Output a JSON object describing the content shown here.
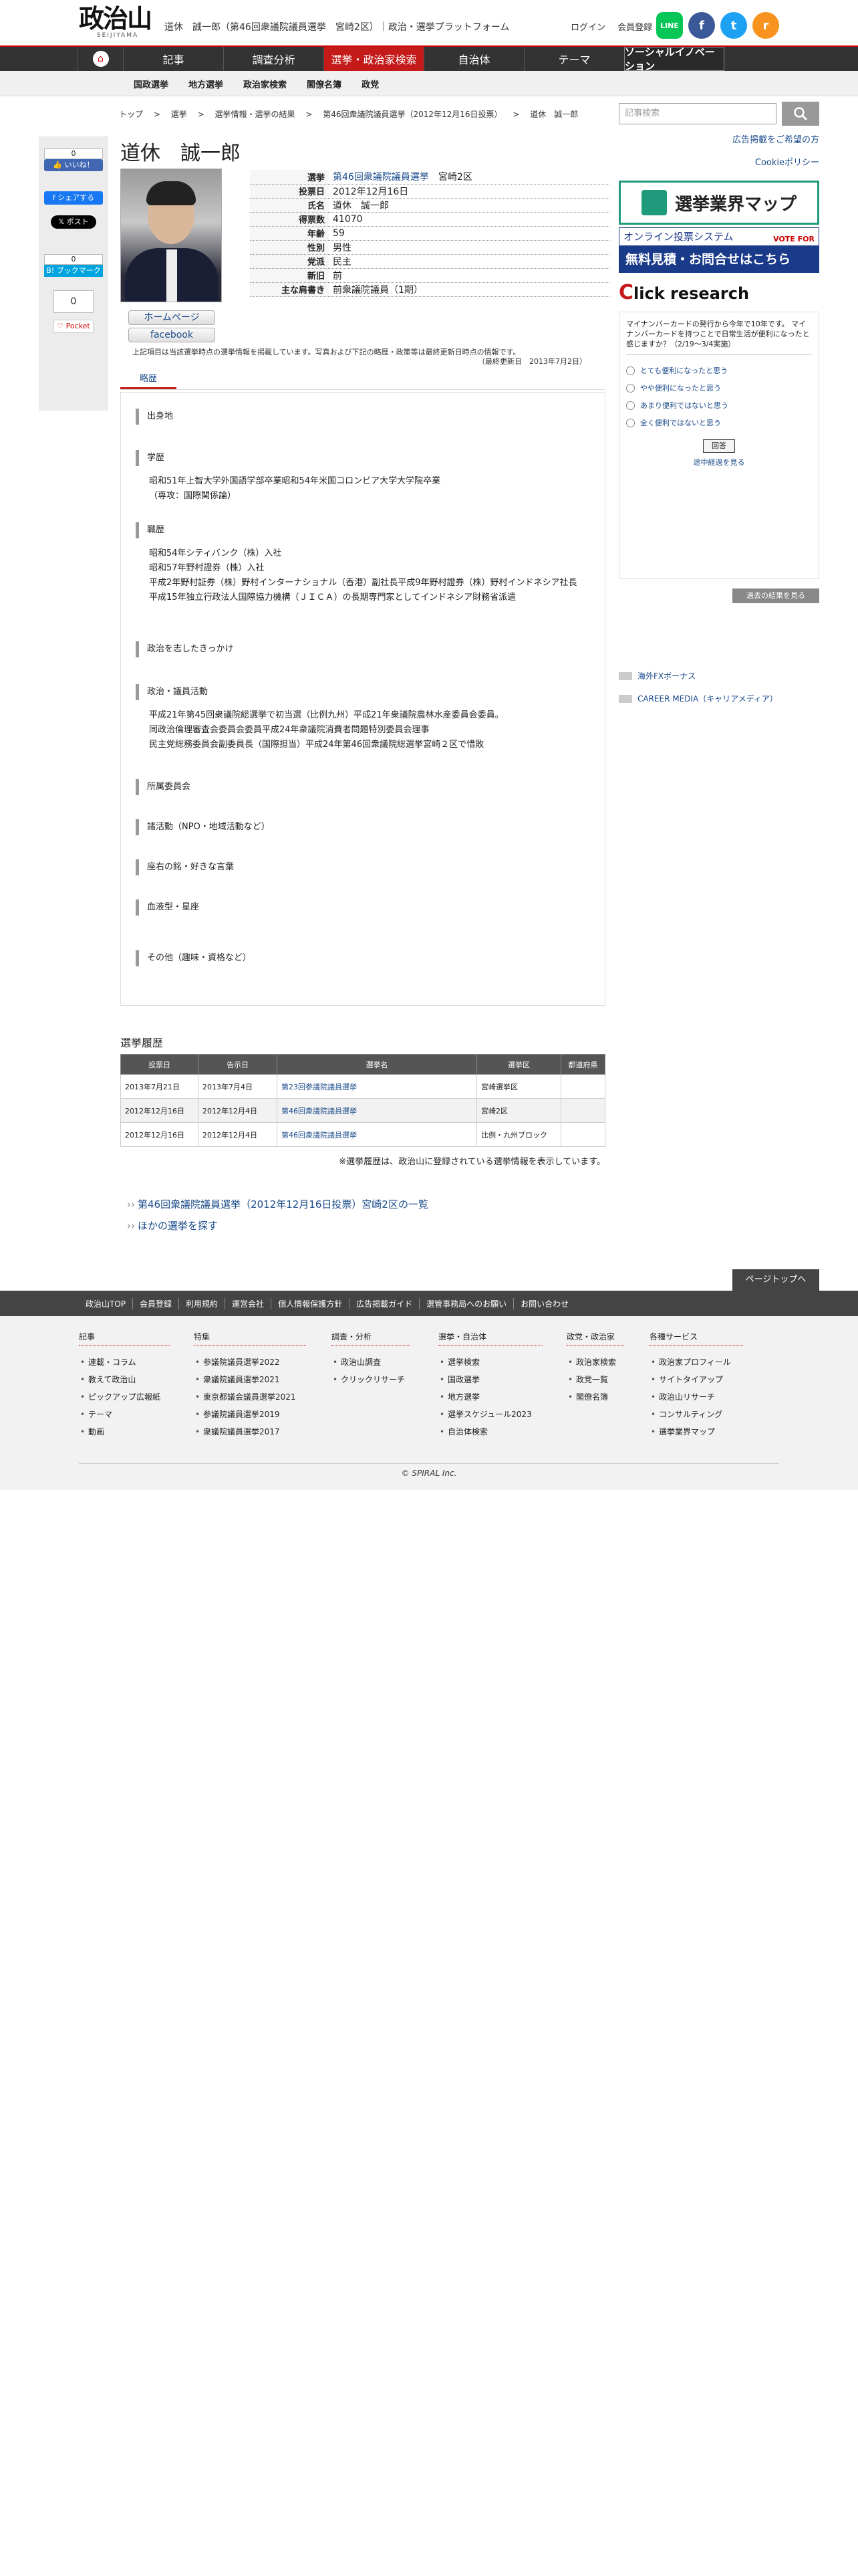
{
  "header": {
    "logo": "政治山",
    "logo_sub": "SEIJIYAMA",
    "title": "道休　誠一郎（第46回衆議院議員選挙　宮崎2区）｜政治・選挙プラットフォーム",
    "login": "ログイン",
    "register": "会員登録",
    "line_label": "LINE",
    "fb_label": "f",
    "tw_label": "t",
    "rss_label": "r"
  },
  "nav": {
    "items": [
      "記事",
      "調査分析",
      "選挙・政治家検索",
      "自治体",
      "テーマ",
      "ソーシャルイノベーション"
    ],
    "active_index": 2
  },
  "subnav": {
    "items": [
      "国政選挙",
      "地方選挙",
      "政治家検索",
      "閣僚名簿",
      "政党"
    ]
  },
  "breadcrumb": {
    "items": [
      "トップ",
      "選挙",
      "選挙情報・選挙の結果",
      "第46回衆議院議員選挙（2012年12月16日投票）",
      "道休　誠一郎"
    ],
    "sep": ">"
  },
  "share": {
    "like_count": "0",
    "like_label": "いいね！",
    "fb_share_label": "シェアする",
    "x_post_label": "ポスト",
    "hatena_count": "0",
    "hatena_label": "B! ブックマーク",
    "pocket_count": "0",
    "pocket_label": "Pocket"
  },
  "profile": {
    "name": "道休　誠一郎",
    "homepage_label": "ホームページ",
    "facebook_label": "facebook",
    "rows": [
      {
        "k": "選挙",
        "v": "第46回衆議院議員選挙",
        "v2": "宮崎2区"
      },
      {
        "k": "投票日",
        "v": "2012年12月16日"
      },
      {
        "k": "氏名",
        "v": "道休　誠一郎"
      },
      {
        "k": "得票数",
        "v": "41070"
      },
      {
        "k": "年齢",
        "v": "59"
      },
      {
        "k": "性別",
        "v": "男性"
      },
      {
        "k": "党派",
        "v": "民主"
      },
      {
        "k": "新旧",
        "v": "前"
      },
      {
        "k": "主な肩書き",
        "v": "前衆議院議員（1期）"
      }
    ],
    "note": "上記項目は当該選挙時点の選挙情報を掲載しています。写真および下記の略歴・政策等は最終更新日時点の情報です。",
    "updated": "（最終更新日　2013年7月2日）",
    "tab_label": "略歴"
  },
  "bio": {
    "sections": [
      {
        "h": "出身地",
        "b": []
      },
      {
        "h": "学歴",
        "b": [
          "昭和51年上智大学外国語学部卒業昭和54年米国コロンビア大学大学院卒業",
          "（専攻：国際関係論）"
        ]
      },
      {
        "h": "職歴",
        "b": [
          "昭和54年シティバンク（株）入社",
          "昭和57年野村證券（株）入社",
          "平成2年野村証券（株）野村インターナショナル（香港）副社長平成9年野村證券（株）野村インドネシア社長",
          "平成15年独立行政法人国際協力機構（ＪＩＣＡ）の長期専門家としてインドネシア財務省派遣"
        ]
      },
      {
        "h": "政治を志したきっかけ",
        "b": []
      },
      {
        "h": "政治・議員活動",
        "b": [
          "平成21年第45回衆議院総選挙で初当選（比例九州）平成21年衆議院農林水産委員会委員。",
          "同政治倫理審査会委員会委員平成24年衆議院消費者問題特別委員会理事",
          "民主党総務委員会副委員長（国際担当）平成24年第46回衆議院総選挙宮崎２区で惜敗"
        ]
      },
      {
        "h": "所属委員会",
        "b": []
      },
      {
        "h": "諸活動（NPO・地域活動など）",
        "b": []
      },
      {
        "h": "座右の銘・好きな言葉",
        "b": []
      },
      {
        "h": "血液型・星座",
        "b": []
      },
      {
        "h": "その他（趣味・資格など）",
        "b": []
      }
    ]
  },
  "history": {
    "title": "選挙履歴",
    "headers": [
      "投票日",
      "告示日",
      "選挙名",
      "選挙区",
      "都道府県"
    ],
    "rows": [
      [
        "2013年7月21日",
        "2013年7月4日",
        "第23回参議院議員選挙",
        "宮崎選挙区",
        ""
      ],
      [
        "2012年12月16日",
        "2012年12月4日",
        "第46回衆議院議員選挙",
        "宮崎2区",
        ""
      ],
      [
        "2012年12月16日",
        "2012年12月4日",
        "第46回衆議院議員選挙",
        "比例・九州ブロック",
        ""
      ]
    ],
    "note": "※選挙履歴は、政治山に登録されている選挙情報を表示しています。",
    "link1": "第46回衆議院議員選挙（2012年12月16日投票）宮崎2区の一覧",
    "link2": "ほかの選挙を探す"
  },
  "sidebar": {
    "search_placeholder": "記事検索",
    "ad_link": "広告掲載をご希望の方",
    "cookie_link": "Cookieポリシー",
    "banner1": "選挙業界マップ",
    "banner2_top": "オンライン投票システム",
    "banner2_vf": "VOTE FOR",
    "banner2_bottom": "無料見積・お問合せはこちら",
    "cr_title_c": "C",
    "cr_title_rest": "lick research",
    "cr_question": "マイナンバーカードの発行から今年で10年です。 マイナンバーカードを持つことで日常生活が便利になったと感じますか？（2/19～3/4実施）",
    "cr_options": [
      "とても便利になったと思う",
      "やや便利になったと思う",
      "あまり便利ではないと思う",
      "全く便利ではないと思う"
    ],
    "cr_vote": "回答",
    "cr_result": "途中経過を見る",
    "past_btn": "過去の結果を見る",
    "ad1": "海外FXボーナス",
    "ad2": "CAREER MEDIA（キャリアメディア）"
  },
  "footer": {
    "pagetop": "ページトップへ",
    "bar": [
      "政治山TOP",
      "会員登録",
      "利用規約",
      "運営会社",
      "個人情報保護方針",
      "広告掲載ガイド",
      "選管事務局へのお願い",
      "お問い合わせ"
    ],
    "cols": [
      {
        "h": "記事",
        "items": [
          "連載・コラム",
          "教えて政治山",
          "ピックアップ広報紙",
          "テーマ",
          "動画"
        ]
      },
      {
        "h": "特集",
        "items": [
          "参議院議員選挙2022",
          "衆議院議員選挙2021",
          "東京都議会議員選挙2021",
          "参議院議員選挙2019",
          "衆議院議員選挙2017"
        ]
      },
      {
        "h": "調査・分析",
        "items": [
          "政治山調査",
          "クリックリサーチ"
        ]
      },
      {
        "h": "選挙・自治体",
        "items": [
          "選挙検索",
          "国政選挙",
          "地方選挙",
          "選挙スケジュール2023",
          "自治体検索"
        ]
      },
      {
        "h": "政党・政治家",
        "items": [
          "政治家検索",
          "政党一覧",
          "閣僚名簿"
        ]
      },
      {
        "h": "各種サービス",
        "items": [
          "政治家プロフィール",
          "サイトタイアップ",
          "政治山リサーチ",
          "コンサルティング",
          "選挙業界マップ"
        ]
      }
    ],
    "copyright": "© SPIRAL Inc."
  }
}
